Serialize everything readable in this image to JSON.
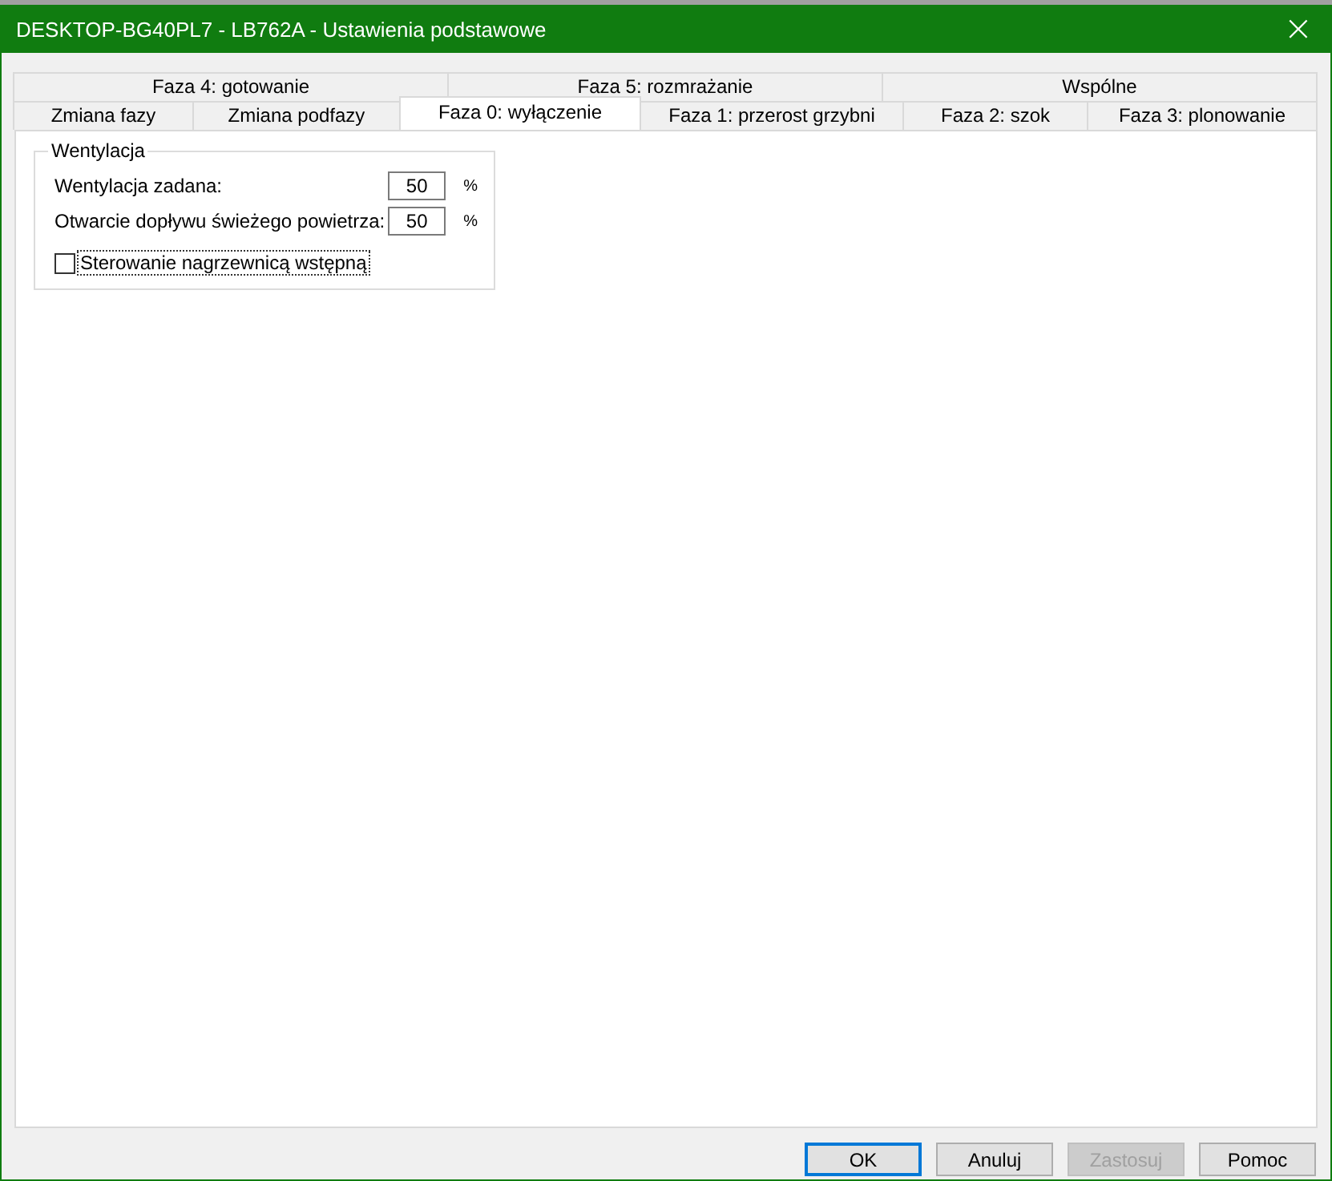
{
  "window": {
    "title": "DESKTOP-BG40PL7 - LB762A - Ustawienia podstawowe",
    "close": "×"
  },
  "tab_rows": [
    {
      "tabs": [
        {
          "label": "Faza 4: gotowanie",
          "selected": false
        },
        {
          "label": "Faza 5: rozmrażanie",
          "selected": false
        },
        {
          "label": "Wspólne",
          "selected": false
        }
      ]
    },
    {
      "tabs": [
        {
          "label": "Zmiana fazy",
          "selected": false
        },
        {
          "label": "Zmiana podfazy",
          "selected": false
        },
        {
          "label": "Faza 0: wyłączenie",
          "selected": true
        },
        {
          "label": "Faza 1: przerost grzybni",
          "selected": false
        },
        {
          "label": "Faza 2: szok",
          "selected": false
        },
        {
          "label": "Faza 3: plonowanie",
          "selected": false
        }
      ]
    }
  ],
  "group": {
    "title": "Wentylacja",
    "fields": [
      {
        "label": "Wentylacja zadana:",
        "value": "50",
        "unit": "%"
      },
      {
        "label": "Otwarcie dopływu świeżego powietrza:",
        "value": "50",
        "unit": "%"
      }
    ],
    "checkbox": {
      "label": "Sterowanie nagrzewnicą wstępną",
      "checked": false,
      "focused": true
    }
  },
  "buttons": [
    {
      "label": "OK",
      "default": true,
      "disabled": false
    },
    {
      "label": "Anuluj",
      "default": false,
      "disabled": false
    },
    {
      "label": "Zastosuj",
      "default": false,
      "disabled": true
    },
    {
      "label": "Pomoc",
      "default": false,
      "disabled": false
    }
  ]
}
